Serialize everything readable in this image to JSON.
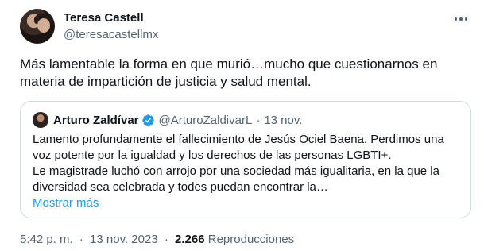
{
  "author": {
    "name": "Teresa Castell",
    "handle": "@teresacastellmx"
  },
  "tweet": {
    "text_line1": "Más lamentable la forma en que murió…mucho que cuestionarnos en",
    "text_line2": "materia de impartición de justicia y salud mental."
  },
  "quote": {
    "name": "Arturo Zaldívar",
    "handle": "@ArturoZaldivarL",
    "separator": "·",
    "date": "13 nov.",
    "line1": "Lamento profundamente el fallecimiento de Jesús Ociel Baena. Perdimos una",
    "line2": "voz potente por la igualdad y los derechos de las personas LGBTI+.",
    "line3": "Le magistrade luchó con arrojo por una sociedad más igualitaria, en la que la",
    "line4": "diversidad sea celebrada y todes puedan encontrar la…",
    "show_more": "Mostrar más"
  },
  "meta": {
    "time": "5:42 p. m.",
    "separator": "·",
    "date": "13 nov. 2023",
    "views_count": "2.266",
    "views_label": "Reproducciones"
  },
  "icons": {
    "more": "more-horizontal-icon",
    "verified": "verified-badge-icon"
  },
  "colors": {
    "primary_text": "#0f1419",
    "secondary_text": "#536471",
    "link": "#1d9bf0",
    "border": "#cfd9de"
  }
}
